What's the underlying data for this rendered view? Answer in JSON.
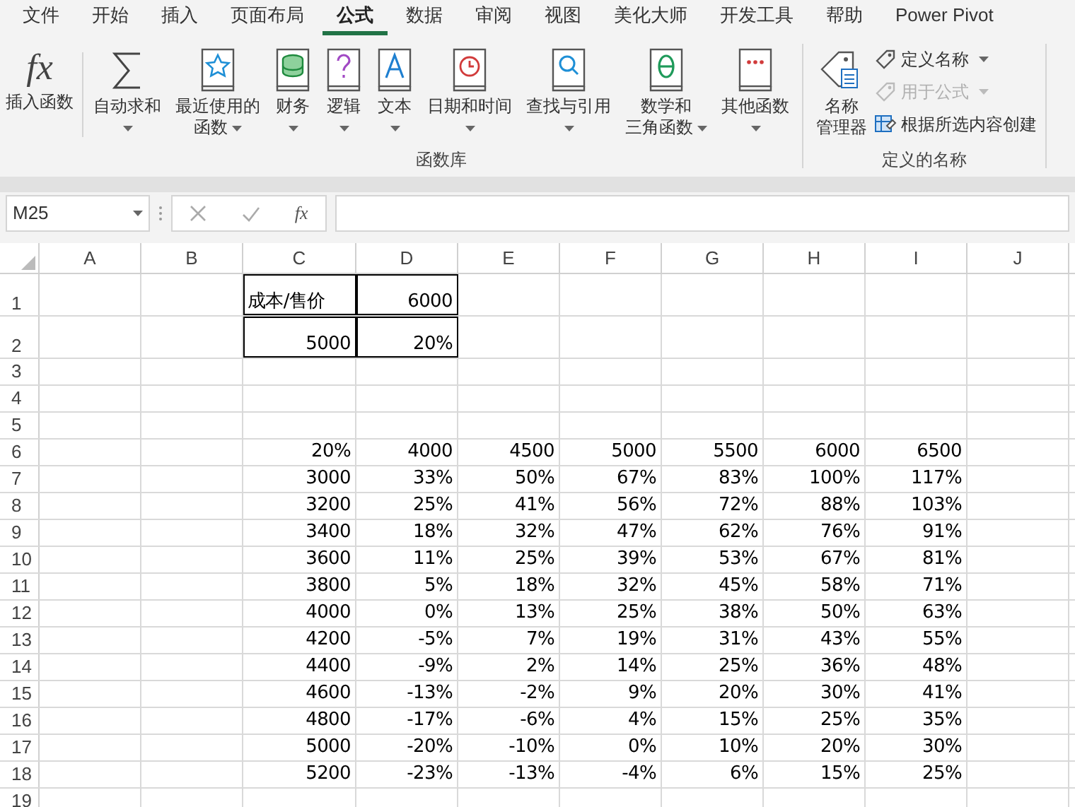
{
  "menu_tabs": [
    {
      "label": "文件",
      "selected": false
    },
    {
      "label": "开始",
      "selected": false
    },
    {
      "label": "插入",
      "selected": false
    },
    {
      "label": "页面布局",
      "selected": false
    },
    {
      "label": "公式",
      "selected": true
    },
    {
      "label": "数据",
      "selected": false
    },
    {
      "label": "审阅",
      "selected": false
    },
    {
      "label": "视图",
      "selected": false
    },
    {
      "label": "美化大师",
      "selected": false
    },
    {
      "label": "开发工具",
      "selected": false
    },
    {
      "label": "帮助",
      "selected": false
    },
    {
      "label": "Power Pivot",
      "selected": false
    }
  ],
  "ribbon": {
    "insert_function": {
      "glyph": "fx",
      "lines": [
        "插入函数"
      ]
    },
    "function_library": {
      "title": "函数库",
      "buttons": [
        {
          "kind": "sum",
          "lines": [
            "自动求和"
          ],
          "dropdown": true
        },
        {
          "kind": "star",
          "lines": [
            "最近使用的",
            "函数"
          ],
          "dropdown": true
        },
        {
          "kind": "coins",
          "lines": [
            "财务"
          ],
          "dropdown": true
        },
        {
          "kind": "question",
          "lines": [
            "逻辑"
          ],
          "dropdown": true
        },
        {
          "kind": "letter",
          "lines": [
            "文本"
          ],
          "dropdown": true
        },
        {
          "kind": "clock",
          "lines": [
            "日期和时间"
          ],
          "dropdown": true
        },
        {
          "kind": "search",
          "lines": [
            "查找与引用"
          ],
          "dropdown": true
        },
        {
          "kind": "theta",
          "lines": [
            "数学和",
            "三角函数"
          ],
          "dropdown": true
        },
        {
          "kind": "dots",
          "lines": [
            "其他函数"
          ],
          "dropdown": true
        }
      ]
    },
    "defined_names": {
      "title": "定义的名称",
      "manager": {
        "lines": [
          "名称",
          "管理器"
        ]
      },
      "small_buttons": [
        {
          "kind": "tag",
          "label": "定义名称",
          "dropdown": true,
          "disabled": false
        },
        {
          "kind": "tag",
          "label": "用于公式",
          "dropdown": true,
          "disabled": true
        },
        {
          "kind": "grid",
          "label": "根据所选内容创建",
          "dropdown": false,
          "disabled": false
        }
      ]
    }
  },
  "formula_bar": {
    "name_box": "M25",
    "function_glyph": "fx"
  },
  "sheet": {
    "columns": [
      "A",
      "B",
      "C",
      "D",
      "E",
      "F",
      "G",
      "H",
      "I",
      "J"
    ],
    "rows": [
      {
        "header": "1",
        "tall": true,
        "cells": [
          null,
          null,
          {
            "text": "成本/售价",
            "kind": "text",
            "bordered": true
          },
          {
            "text": "6000",
            "kind": "number",
            "bordered": true
          },
          null,
          null,
          null,
          null,
          null,
          null
        ]
      },
      {
        "header": "2",
        "tall": true,
        "cells": [
          null,
          null,
          {
            "text": "5000",
            "kind": "number",
            "bordered": true
          },
          {
            "text": "20%",
            "kind": "number",
            "bordered": true
          },
          null,
          null,
          null,
          null,
          null,
          null
        ]
      },
      {
        "header": "3",
        "tall": false,
        "cells": []
      },
      {
        "header": "4",
        "tall": false,
        "cells": []
      },
      {
        "header": "5",
        "tall": false,
        "cells": []
      },
      {
        "header": "6",
        "tall": false,
        "cells": [
          null,
          null,
          {
            "text": "20%",
            "kind": "number",
            "bordered": false
          },
          {
            "text": "4000",
            "kind": "number",
            "bordered": false
          },
          {
            "text": "4500",
            "kind": "number",
            "bordered": false
          },
          {
            "text": "5000",
            "kind": "number",
            "bordered": false
          },
          {
            "text": "5500",
            "kind": "number",
            "bordered": false
          },
          {
            "text": "6000",
            "kind": "number",
            "bordered": false
          },
          {
            "text": "6500",
            "kind": "number",
            "bordered": false
          },
          null
        ]
      },
      {
        "header": "7",
        "tall": false,
        "values": [
          "3000",
          "33%",
          "50%",
          "67%",
          "83%",
          "100%",
          "117%"
        ]
      },
      {
        "header": "8",
        "tall": false,
        "values": [
          "3200",
          "25%",
          "41%",
          "56%",
          "72%",
          "88%",
          "103%"
        ]
      },
      {
        "header": "9",
        "tall": false,
        "values": [
          "3400",
          "18%",
          "32%",
          "47%",
          "62%",
          "76%",
          "91%"
        ]
      },
      {
        "header": "10",
        "tall": false,
        "values": [
          "3600",
          "11%",
          "25%",
          "39%",
          "53%",
          "67%",
          "81%"
        ]
      },
      {
        "header": "11",
        "tall": false,
        "values": [
          "3800",
          "5%",
          "18%",
          "32%",
          "45%",
          "58%",
          "71%"
        ]
      },
      {
        "header": "12",
        "tall": false,
        "values": [
          "4000",
          "0%",
          "13%",
          "25%",
          "38%",
          "50%",
          "63%"
        ]
      },
      {
        "header": "13",
        "tall": false,
        "values": [
          "4200",
          "-5%",
          "7%",
          "19%",
          "31%",
          "43%",
          "55%"
        ]
      },
      {
        "header": "14",
        "tall": false,
        "values": [
          "4400",
          "-9%",
          "2%",
          "14%",
          "25%",
          "36%",
          "48%"
        ]
      },
      {
        "header": "15",
        "tall": false,
        "values": [
          "4600",
          "-13%",
          "-2%",
          "9%",
          "20%",
          "30%",
          "41%"
        ]
      },
      {
        "header": "16",
        "tall": false,
        "values": [
          "4800",
          "-17%",
          "-6%",
          "4%",
          "15%",
          "25%",
          "35%"
        ]
      },
      {
        "header": "17",
        "tall": false,
        "values": [
          "5000",
          "-20%",
          "-10%",
          "0%",
          "10%",
          "20%",
          "30%"
        ]
      },
      {
        "header": "18",
        "tall": false,
        "values": [
          "5200",
          "-23%",
          "-13%",
          "-4%",
          "6%",
          "15%",
          "25%"
        ]
      },
      {
        "header": "19",
        "tall": false,
        "cells": []
      }
    ]
  }
}
